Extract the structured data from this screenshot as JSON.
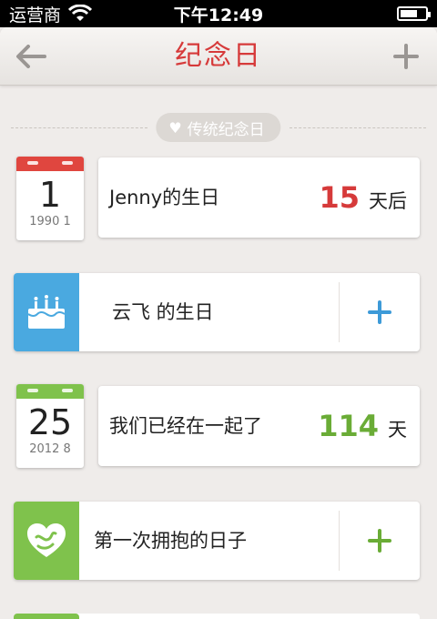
{
  "status_bar": {
    "carrier": "运营商",
    "time": "下午12:49",
    "battery_level": 0.7
  },
  "nav": {
    "title": "纪念日",
    "back_icon": "arrow-left-icon",
    "add_icon": "plus-icon"
  },
  "section": {
    "label": "传统纪念日",
    "icon": "heart-icon"
  },
  "events": [
    {
      "calendar_day": "1",
      "calendar_sub": "1990 1",
      "calendar_color": "#e0463f",
      "name": "Jenny的生日",
      "count": "15",
      "count_color": "#d63a3a",
      "unit": "天后"
    },
    {
      "calendar_day": "25",
      "calendar_sub": "2012 8",
      "calendar_color": "#7fc24c",
      "name": "我们已经在一起了",
      "count": "114",
      "count_color": "#6aac36",
      "unit": "天"
    }
  ],
  "suggestions": [
    {
      "label": "云飞 的生日",
      "icon": "birthday-cake-icon",
      "icon_bg": "#4aa9e0",
      "plus_color": "#3d9ad8"
    },
    {
      "label": "第一次拥抱的日子",
      "icon": "hug-heart-icon",
      "icon_bg": "#7fc24c",
      "plus_color": "#6aac36"
    }
  ]
}
